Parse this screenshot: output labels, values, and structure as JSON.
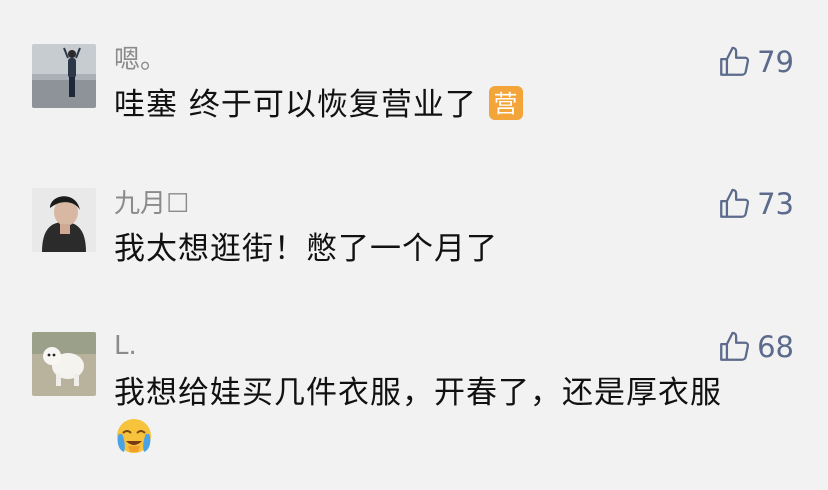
{
  "comments": [
    {
      "avatar": "avatar-photo-beach",
      "username": "嗯。",
      "likes": "79",
      "text": "哇塞 终于可以恢复营业了",
      "trailing_emoji": "营"
    },
    {
      "avatar": "avatar-photo-portrait",
      "username": "九月",
      "username_suffix": "☐",
      "likes": "73",
      "text": "我太想逛街！憋了一个月了"
    },
    {
      "avatar": "avatar-photo-dog",
      "username": "L.",
      "likes": "68",
      "text": "我想给娃买几件衣服，开春了，还是厚衣服",
      "trailing_emoji": "crying-face"
    }
  ],
  "icons": {
    "like": "thumbs-up-icon"
  },
  "colors": {
    "background": "#f2f2f2",
    "like": "#5c6a8c",
    "username": "#8b8b8b"
  }
}
